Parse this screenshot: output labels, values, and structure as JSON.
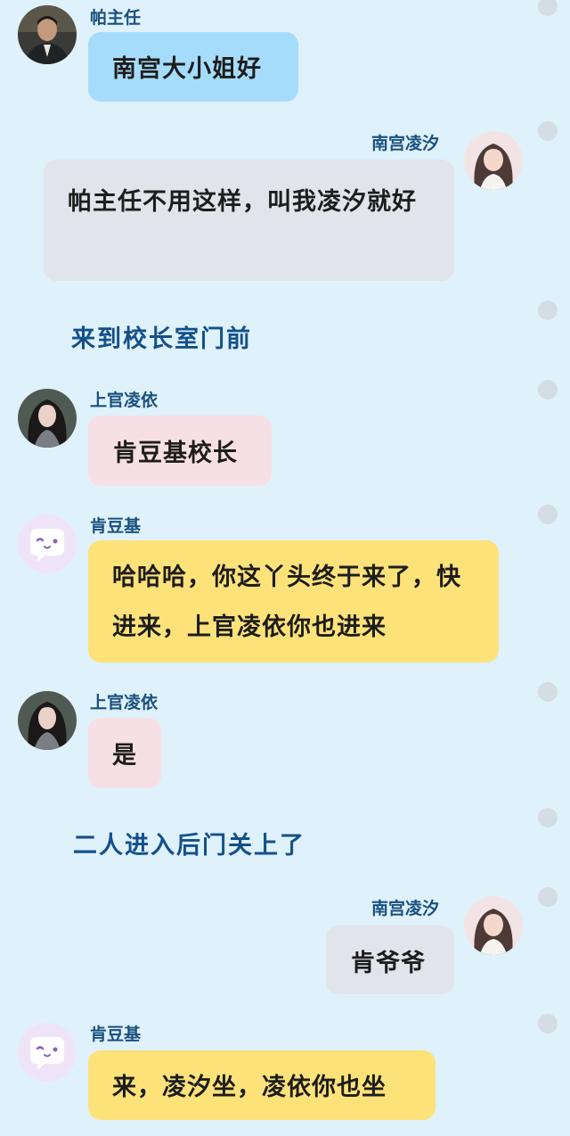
{
  "messages": [
    {
      "speaker": "帕主任",
      "text": "南宫大小姐好"
    },
    {
      "speaker": "南宫凌汐",
      "text": "帕主任不用这样，叫我凌汐就好"
    },
    {
      "narration": "来到校长室门前"
    },
    {
      "speaker": "上官凌依",
      "text": "肯豆基校长"
    },
    {
      "speaker": "肯豆基",
      "text": "哈哈哈，你这丫头终于来了，快进来，上官凌依你也进来"
    },
    {
      "speaker": "上官凌依",
      "text": "是"
    },
    {
      "narration": "二人进入后门关上了"
    },
    {
      "speaker": "南宫凌汐",
      "text": "肯爷爷"
    },
    {
      "speaker": "肯豆基",
      "text": "来，凌汐坐，凌依你也坐"
    }
  ]
}
